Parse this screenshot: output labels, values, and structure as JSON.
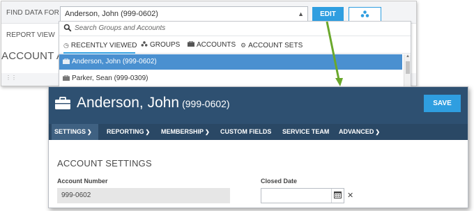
{
  "background_window": {
    "find_label": "FIND DATA FOR",
    "find_value": "Anderson, John (999-0602)",
    "edit_label": "EDIT",
    "report_view_label": "REPORT VIEW",
    "account_heading": "ACCOUNT ANA"
  },
  "dropdown": {
    "search_placeholder": "Search Groups and Accounts",
    "tabs": [
      {
        "label": "RECENTLY VIEWED",
        "icon": "clock-icon",
        "active": true
      },
      {
        "label": "GROUPS",
        "icon": "group-icon"
      },
      {
        "label": "ACCOUNTS",
        "icon": "briefcase-icon"
      },
      {
        "label": "ACCOUNT SETS",
        "icon": "gears-icon"
      }
    ],
    "items": [
      {
        "label": "Anderson, John (999-0602)",
        "selected": true
      },
      {
        "label": "Parker, Sean (999-0309)",
        "selected": false
      }
    ]
  },
  "account_window": {
    "name": "Anderson, John",
    "number": "(999-0602)",
    "save_label": "SAVE",
    "nav": [
      {
        "label": "SETTINGS",
        "dropdown": true,
        "active": true
      },
      {
        "label": "REPORTING",
        "dropdown": true
      },
      {
        "label": "MEMBERSHIP",
        "dropdown": true
      },
      {
        "label": "CUSTOM FIELDS",
        "dropdown": false
      },
      {
        "label": "SERVICE TEAM",
        "dropdown": false
      },
      {
        "label": "ADVANCED",
        "dropdown": true
      }
    ],
    "section_title": "ACCOUNT SETTINGS",
    "account_number_label": "Account Number",
    "account_number_value": "999-0602",
    "closed_date_label": "Closed Date",
    "closed_date_value": ""
  },
  "colors": {
    "accent": "#2f9ee0",
    "header": "#2e5071",
    "nav": "#2a4865",
    "selected_row": "#4a90d0",
    "arrow": "#6aa82c"
  }
}
